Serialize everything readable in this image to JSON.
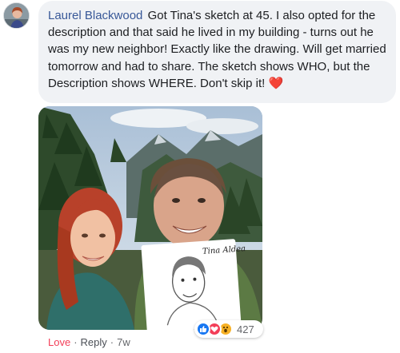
{
  "comment": {
    "author": "Laurel Blackwood",
    "text": "Got Tina's sketch at 45. I also opted for the description and that said he lived in my building - turns out he was my new neighbor! Exactly like the drawing. Will get married tomorrow and had to share. The sketch shows WHO, but the Description shows WHERE. Don't skip it!",
    "emoji": "❤️"
  },
  "photo": {
    "sketch_signature": "Tina Aldea"
  },
  "reactions": {
    "icons": [
      "like-icon",
      "love-icon",
      "wow-icon"
    ],
    "count": "427",
    "colors": {
      "like": "#1877f2",
      "love": "#f33e58",
      "wow": "#f7b125"
    }
  },
  "actions": {
    "love_label": "Love",
    "separator": "·",
    "reply_label": "Reply",
    "time": "7w"
  }
}
